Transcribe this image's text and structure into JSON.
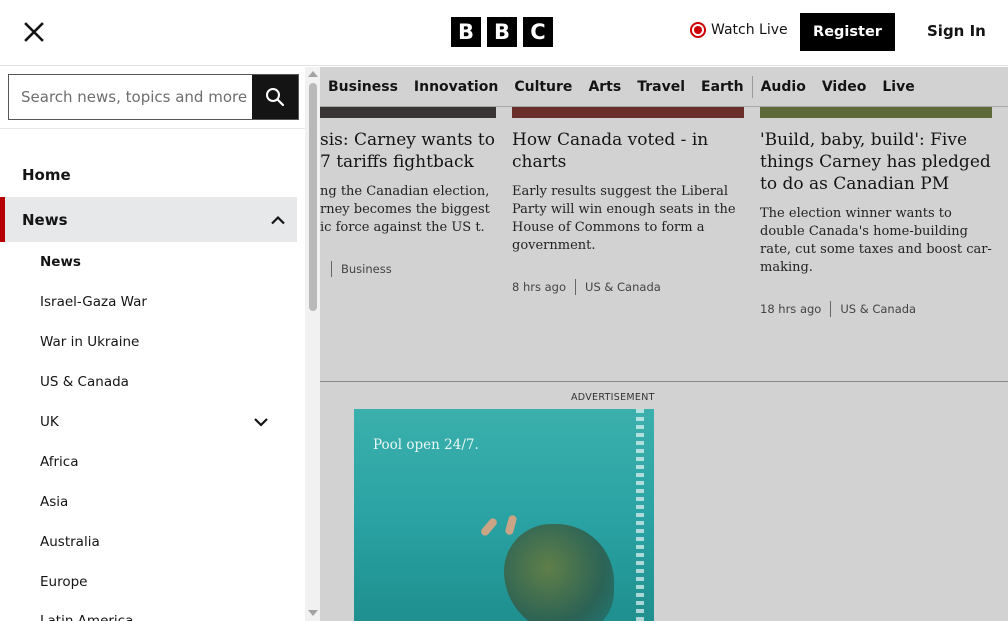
{
  "header": {
    "logo_letters": [
      "B",
      "B",
      "C"
    ],
    "watch_live": "Watch Live",
    "register": "Register",
    "sign_in": "Sign In"
  },
  "topnav": {
    "items": [
      "Business",
      "Innovation",
      "Culture",
      "Arts",
      "Travel",
      "Earth",
      "Audio",
      "Video",
      "Live"
    ]
  },
  "cards": [
    {
      "title": "sis: Carney wants to 7 tariffs fightback",
      "summary": "ng the Canadian election, rney becomes the biggest ic force against the US t.",
      "time": "",
      "category": "Business"
    },
    {
      "title": "How Canada voted - in charts",
      "summary": "Early results suggest the Liberal Party will win enough seats in the House of Commons to form a government.",
      "time": "8 hrs ago",
      "category": "US & Canada"
    },
    {
      "title": "'Build, baby, build': Five things Carney has pledged to do as Canadian PM",
      "summary": "The election winner wants to double Canada's home-building rate, cut some taxes and boost car-making.",
      "time": "18 hrs ago",
      "category": "US & Canada"
    }
  ],
  "advertisement": {
    "label": "ADVERTISEMENT",
    "text": "Pool open 24/7."
  },
  "sidebar": {
    "search_placeholder": "Search news, topics and more",
    "home": "Home",
    "news": "News",
    "sub_items": [
      "News",
      "Israel-Gaza War",
      "War in Ukraine",
      "US & Canada",
      "UK",
      "Africa",
      "Asia",
      "Australia",
      "Europe",
      "Latin America"
    ]
  },
  "colors": {
    "accent_red": "#b80000",
    "live_red": "#cc0000",
    "black": "#000000",
    "overlay_grey": "#d2d2d2"
  }
}
